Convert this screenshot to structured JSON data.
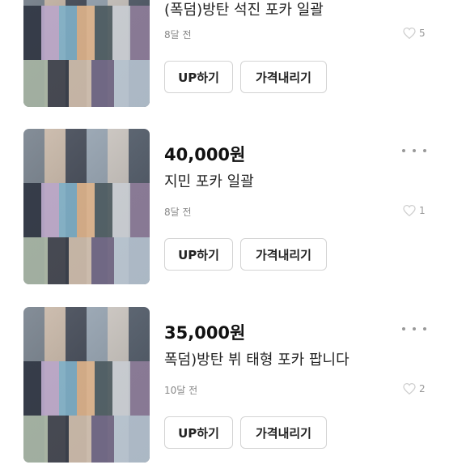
{
  "listings": [
    {
      "price": "",
      "title": "(폭덤)방탄 석진 포카 일괄",
      "time": "8달 전",
      "likes": "5",
      "image_icon": "photocard-collage-image",
      "up_label": "UP하기",
      "price_down_label": "가격내리기"
    },
    {
      "price": "40,000원",
      "title": "지민 포카 일괄",
      "time": "8달 전",
      "likes": "1",
      "image_icon": "photocard-collage-image",
      "up_label": "UP하기",
      "price_down_label": "가격내리기"
    },
    {
      "price": "35,000원",
      "title": "폭덤)방탄 뷔 태형 포카 팝니다",
      "time": "10달 전",
      "likes": "2",
      "image_icon": "photocard-collage-image",
      "up_label": "UP하기",
      "price_down_label": "가격내리기"
    }
  ],
  "colors": {
    "text": "#111111",
    "muted": "#888888",
    "border": "#d3d3d3"
  }
}
